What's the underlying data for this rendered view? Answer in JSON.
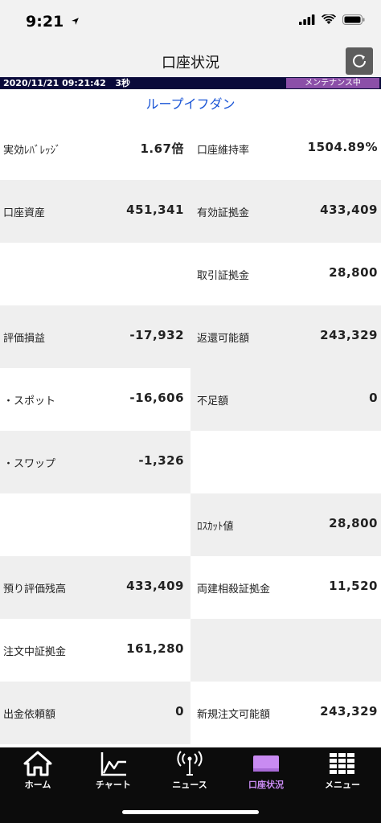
{
  "status": {
    "time": "9:21"
  },
  "header": {
    "title": "口座状況"
  },
  "info_bar": {
    "timestamp": "2020/11/21 09:21:42",
    "interval": "3秒",
    "maintenance": "メンテナンス中"
  },
  "loop_title": "ループイフダン",
  "rows": [
    {
      "left": {
        "label": "実効ﾚﾊﾞﾚｯｼﾞ",
        "value": "1.67倍"
      },
      "right": {
        "label": "口座維持率",
        "value": "1504.89%"
      }
    },
    {
      "left": {
        "label": "口座資産",
        "value": "451,341"
      },
      "right": {
        "label": "有効証拠金",
        "value": "433,409"
      }
    },
    {
      "left": {
        "label": "",
        "value": ""
      },
      "right": {
        "label": "取引証拠金",
        "value": "28,800"
      }
    },
    {
      "left": {
        "label": "評価損益",
        "value": "-17,932"
      },
      "right": {
        "label": "返還可能額",
        "value": "243,329"
      }
    },
    {
      "left": {
        "label": "・スポット",
        "value": "-16,606"
      },
      "right": {
        "label": "不足額",
        "value": "0"
      }
    },
    {
      "left": {
        "label": "・スワップ",
        "value": "-1,326"
      },
      "right": {
        "label": "",
        "value": ""
      }
    },
    {
      "left": {
        "label": "",
        "value": ""
      },
      "right": {
        "label": "ﾛｽｶｯﾄ値",
        "value": "28,800"
      }
    },
    {
      "left": {
        "label": "預り評価残高",
        "value": "433,409"
      },
      "right": {
        "label": "両建相殺証拠金",
        "value": "11,520"
      }
    },
    {
      "left": {
        "label": "注文中証拠金",
        "value": "161,280"
      },
      "right": {
        "label": "",
        "value": ""
      }
    },
    {
      "left": {
        "label": "出金依頼額",
        "value": "0"
      },
      "right": {
        "label": "新規注文可能額",
        "value": "243,329"
      }
    }
  ],
  "tabs": [
    {
      "label": "ホーム",
      "icon": "home-icon"
    },
    {
      "label": "チャート",
      "icon": "chart-icon"
    },
    {
      "label": "ニュース",
      "icon": "news-icon"
    },
    {
      "label": "口座状況",
      "icon": "account-icon"
    },
    {
      "label": "メニュー",
      "icon": "menu-grid-icon"
    }
  ],
  "colors": {
    "accent": "#1a55d6",
    "active_tab": "#c98bf2",
    "maintenance": "#8b4fa8",
    "info_bar": "#0a0a3a"
  }
}
